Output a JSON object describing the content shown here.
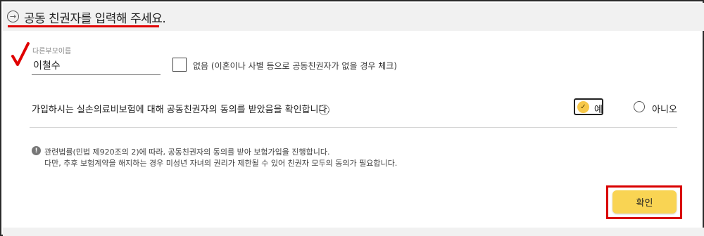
{
  "header": {
    "title": "공동 친권자를 입력해 주세요.",
    "arrow_glyph": "→"
  },
  "colors": {
    "accent_red": "#e00000",
    "button_yellow": "#f9d453",
    "selected_yellow": "#f7c84a"
  },
  "name_field": {
    "label": "다른부모이름",
    "value": "이철수",
    "required_mark_color": "#e00000"
  },
  "none_option": {
    "checked": false,
    "label": "없음 (이혼이나 사별 등으로 공동친권자가 없을 경우 체크)"
  },
  "consent": {
    "question": "가입하시는 실손의료비보험에 대해 공동친권자의 동의를 받았음을 확인합니다.",
    "help_glyph": "?",
    "yes_label": "예",
    "no_label": "아니오",
    "selected": "yes",
    "check_glyph": "✓"
  },
  "notice": {
    "icon_glyph": "!",
    "line1": "관련법률(민법 제920조의 2)에 따라, 공동친권자의 동의를 받아 보험가입을 진행합니다.",
    "line2": "다만, 추후 보험계약을 해지하는 경우 미성년 자녀의 권리가 제한될 수 있어 친권자 모두의 동의가 필요합니다."
  },
  "confirm_button": {
    "label": "확인"
  }
}
